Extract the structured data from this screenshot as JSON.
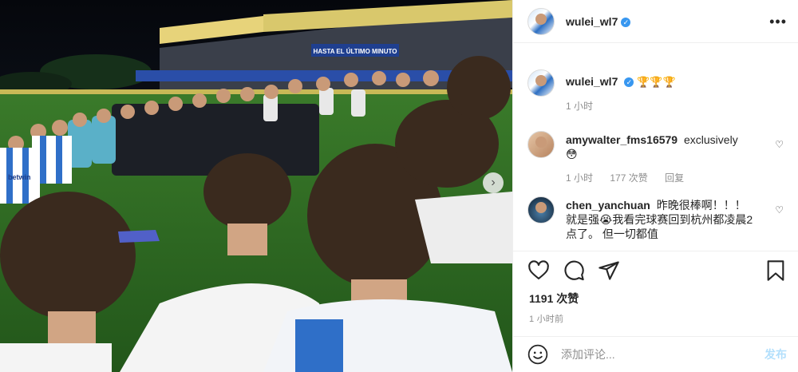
{
  "photo": {
    "stadium_banner": "HASTA EL ÚLTIMO MINUTO",
    "jersey_text": "bet⁠win",
    "alt": "team huddle on football pitch at night"
  },
  "post": {
    "author": "wulei_wl7",
    "more_icon": "ellipsis-icon",
    "caption_trophies": "🏆🏆🏆",
    "caption_time": "1 小时",
    "likes": "1191 次赞",
    "posted_time": "1 小时前"
  },
  "comments": [
    {
      "user": "amywalter_fms16579",
      "text": "exclusively",
      "emoji": "😳",
      "time": "1 小时",
      "likes": "177 次赞",
      "reply": "回复"
    },
    {
      "user": "chen_yanchuan",
      "text": "昨晚很棒啊！！！ 就是强😭我看完球赛回到杭州都凌晨2点了。 但一切都值"
    }
  ],
  "add_comment": {
    "placeholder": "添加评论...",
    "post_label": "发布"
  },
  "colors": {
    "verified": "#3897f0",
    "post_button": "#b2dffc",
    "pitch": "#2f6b24"
  }
}
